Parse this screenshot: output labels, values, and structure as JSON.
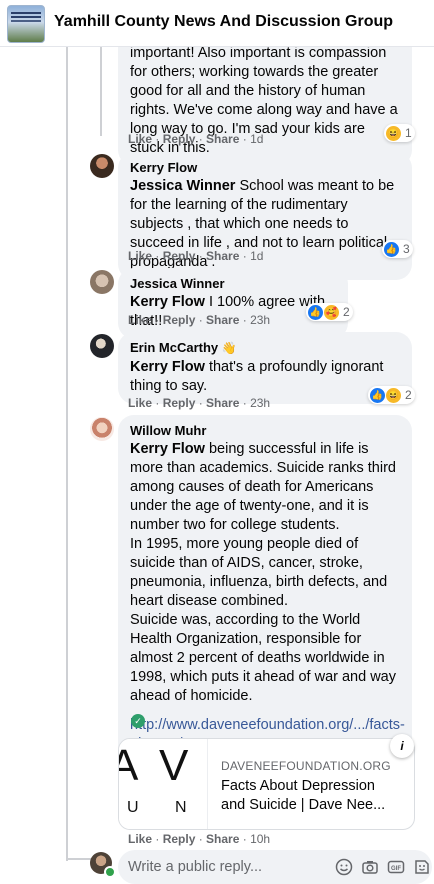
{
  "header": {
    "group_name": "Yamhill County News And Discussion Group"
  },
  "comments": [
    {
      "author": "",
      "text": "important! Also important is compassion for others; working towards the greater good for all and the history of human rights. We've come along way and have a long way to go. I'm sad your kids are stuck in this.",
      "actions": {
        "like": "Like",
        "reply": "Reply",
        "share": "Share",
        "time": "1d"
      },
      "reactions": {
        "count": "1",
        "icons": [
          "haha"
        ]
      }
    },
    {
      "author": "Kerry Flow",
      "mention": "Jessica Winner",
      "text": "School was meant to be for the learning of the rudimentary subjects , that which one needs to succeed in life , and not to learn political propaganda .",
      "actions": {
        "like": "Like",
        "reply": "Reply",
        "share": "Share",
        "time": "1d"
      },
      "reactions": {
        "count": "3",
        "icons": [
          "like"
        ]
      }
    },
    {
      "author": "Jessica Winner",
      "mention": "Kerry Flow",
      "text": "I 100% agree with that!!",
      "actions": {
        "like": "Like",
        "reply": "Reply",
        "share": "Share",
        "time": "23h"
      },
      "reactions": {
        "count": "2",
        "icons": [
          "like",
          "care"
        ]
      }
    },
    {
      "author": "Erin McCarthy",
      "mention": "Kerry Flow",
      "text": "that's a profoundly ignorant thing to say.",
      "actions": {
        "like": "Like",
        "reply": "Reply",
        "share": "Share",
        "time": "23h"
      },
      "reactions": {
        "count": "2",
        "icons": [
          "like",
          "haha"
        ]
      }
    },
    {
      "author": "Willow Muhr",
      "mention": "Kerry Flow",
      "text": "being successful in life is more than academics. Suicide ranks third among causes of death for Americans under the age of twenty-one, and it is number two for college students.",
      "text2": "In 1995, more young people died of suicide than of AIDS, cancer, stroke, pneumonia, influenza, birth defects, and heart disease combined.",
      "text3": "Suicide was, according to the World Health Organization, responsible for almost 2 percent of deaths worldwide in 1998, which puts it ahead of war and way ahead of homicide.",
      "link": "http://www.daveneefoundation.org/.../facts-about.../",
      "actions": {
        "like": "Like",
        "reply": "Reply",
        "share": "Share",
        "time": "10h"
      }
    }
  ],
  "link_card": {
    "domain": "DAVENEEFOUNDATION.ORG",
    "title": "Facts About Depression and Suicide | Dave Nee...",
    "info": "i",
    "logo_letters": [
      "A",
      "V",
      "U",
      "N"
    ]
  },
  "reply_box": {
    "placeholder": "Write a public reply..."
  },
  "icons": {
    "emoji": "emoji-icon",
    "camera": "camera-icon",
    "gif": "gif-icon",
    "sticker": "sticker-icon"
  },
  "colors": {
    "bubble": "#f0f2f5",
    "link": "#385898",
    "like_blue": "#1877f2",
    "online": "#31a24c"
  }
}
